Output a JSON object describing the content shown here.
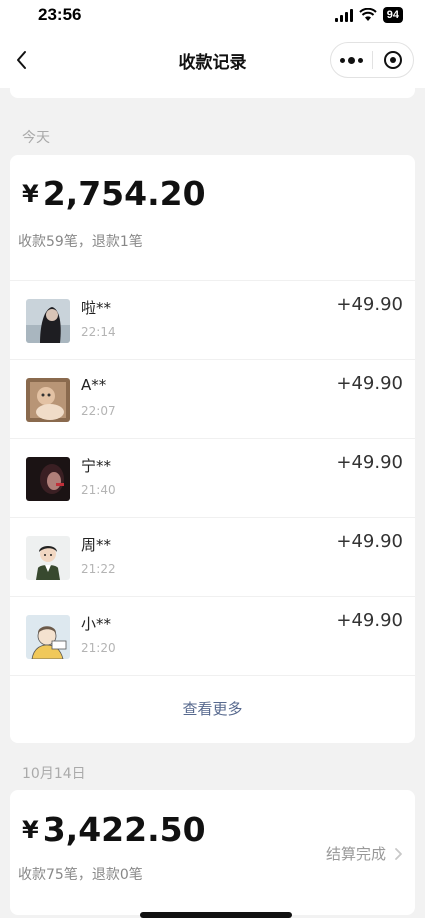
{
  "status_bar": {
    "time": "23:56",
    "battery": "94"
  },
  "nav": {
    "title": "收款记录"
  },
  "today": {
    "label": "今天",
    "total": "2,754.20",
    "currency": "¥",
    "summary": "收款59笔，退款1笔",
    "transactions": [
      {
        "name": "啦**",
        "time": "22:14",
        "amount": "+49.90",
        "avatar": "avatar-dark-hair"
      },
      {
        "name": "A**",
        "time": "22:07",
        "amount": "+49.90",
        "avatar": "avatar-baby"
      },
      {
        "name": "宁**",
        "time": "21:40",
        "amount": "+49.90",
        "avatar": "avatar-dark-portrait"
      },
      {
        "name": "周**",
        "time": "21:22",
        "amount": "+49.90",
        "avatar": "avatar-cartoon-man"
      },
      {
        "name": "小**",
        "time": "21:20",
        "amount": "+49.90",
        "avatar": "avatar-sketch"
      }
    ],
    "more_label": "查看更多"
  },
  "oct14": {
    "label": "10月14日",
    "total": "3,422.50",
    "currency": "¥",
    "summary": "收款75笔，退款0笔",
    "settle_label": "结算完成"
  },
  "colors": {
    "link": "#57698e",
    "background": "#f2f2f2"
  }
}
